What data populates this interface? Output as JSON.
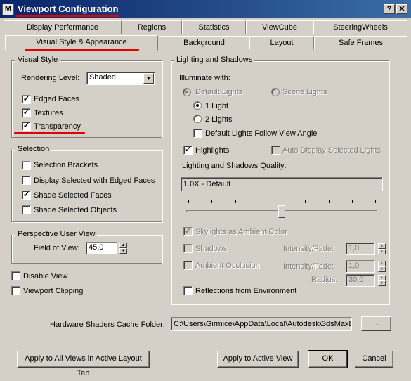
{
  "window": {
    "title": "Viewport Configuration",
    "app_icon_text": "M",
    "help_glyph": "?",
    "close_glyph": "✕"
  },
  "tabs_row1": [
    "Display Performance",
    "Regions",
    "Statistics",
    "ViewCube",
    "SteeringWheels"
  ],
  "tabs_row2": [
    "Visual Style & Appearance",
    "Background",
    "Layout",
    "Safe Frames"
  ],
  "active_tab": "Visual Style & Appearance",
  "visual_style": {
    "title": "Visual Style",
    "rendering_level_label": "Rendering Level:",
    "rendering_level_value": "Shaded",
    "edged_faces": {
      "label": "Edged Faces",
      "checked": true
    },
    "textures": {
      "label": "Textures",
      "checked": true
    },
    "transparency": {
      "label": "Transparency",
      "checked": true
    }
  },
  "selection": {
    "title": "Selection",
    "selection_brackets": {
      "label": "Selection Brackets",
      "checked": false
    },
    "display_selected_edged": {
      "label": "Display Selected with Edged Faces",
      "checked": false
    },
    "shade_selected_faces": {
      "label": "Shade Selected Faces",
      "checked": true
    },
    "shade_selected_objects": {
      "label": "Shade Selected Objects",
      "checked": false
    }
  },
  "perspective": {
    "title": "Perspective User View",
    "fov_label": "Field of View:",
    "fov_value": "45,0"
  },
  "disable_view": {
    "label": "Disable View",
    "checked": false
  },
  "viewport_clipping": {
    "label": "Viewport Clipping",
    "checked": false
  },
  "lighting": {
    "title": "Lighting and Shadows",
    "illuminate_label": "Illuminate with:",
    "default_lights": "Default Lights",
    "scene_lights": "Scene Lights",
    "one_light": "1 Light",
    "two_lights": "2 Lights",
    "follow_view_angle": "Default Lights Follow View Angle",
    "highlights": {
      "label": "Highlights",
      "checked": true
    },
    "auto_display": {
      "label": "Auto Display Selected Lights",
      "checked": false
    },
    "quality_label": "Lighting and Shadows Quality:",
    "quality_value": "1.0X - Default",
    "quality_slider_fraction": 0.5,
    "skylights": {
      "label": "Skylights as Ambient Color",
      "checked": true
    },
    "shadows": {
      "label": "Shadows",
      "checked": false
    },
    "intensity_label_1": "Intensity/Fade:",
    "intensity_value_1": "1,0",
    "ambient_occlusion": {
      "label": "Ambient Occlusion",
      "checked": false
    },
    "intensity_label_2": "Intensity/Fade:",
    "intensity_value_2": "1,0",
    "radius_label": "Radius:",
    "radius_value": "30,0",
    "reflections": {
      "label": "Reflections from Environment",
      "checked": false
    }
  },
  "cache": {
    "label": "Hardware Shaders Cache Folder:",
    "path": "C:\\Users\\Girmice\\AppData\\Local\\Autodesk\\3dsMaxD",
    "browse_label": "..."
  },
  "buttons": {
    "apply_all": "Apply to All Views in Active Layout Tab",
    "apply_active": "Apply to Active View",
    "ok": "OK",
    "cancel": "Cancel"
  },
  "glyphs": {
    "check": "✓",
    "arrow_down": "▼",
    "arrow_up": "▲"
  },
  "annotation_color": "#e00000"
}
